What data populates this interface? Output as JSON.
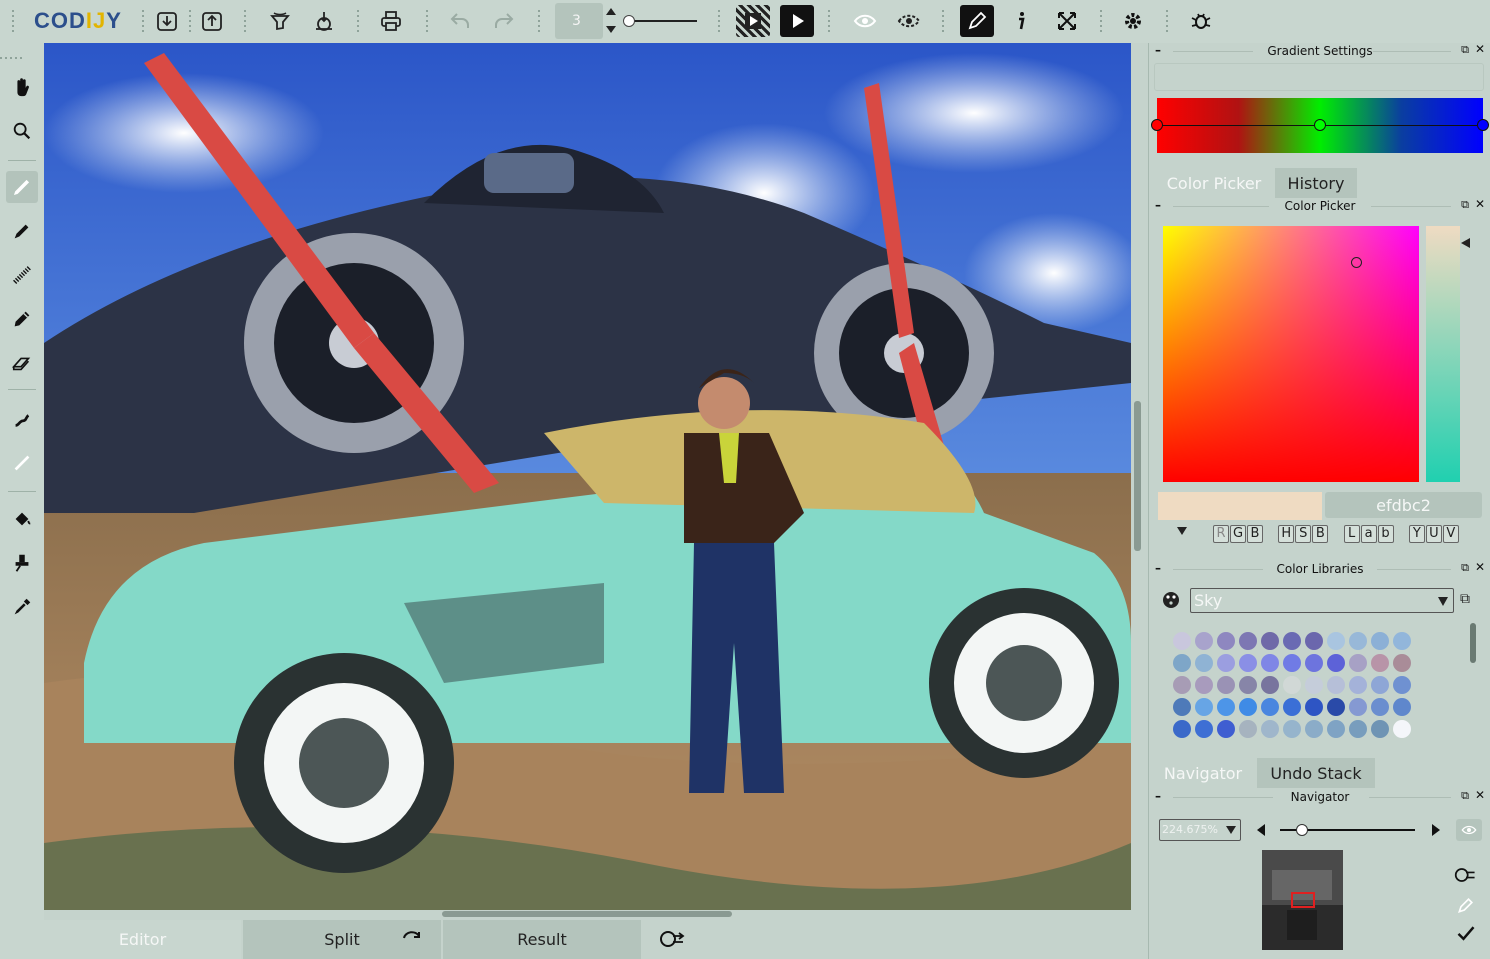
{
  "app": {
    "logo": "CODIJY",
    "logo_parts": [
      "COD",
      "IJ",
      "Y"
    ]
  },
  "toolbar": {
    "brush_size": "3",
    "icons": [
      "open-icon",
      "export-icon",
      "colorize-icon",
      "save-icon",
      "print-icon",
      "undo-icon",
      "redo-icon",
      "preview-hatched-icon",
      "play-icon",
      "eye-icon",
      "eye-masked-icon",
      "pen-active-icon",
      "info-icon",
      "fullscreen-icon",
      "settings-icon",
      "bug-icon"
    ]
  },
  "left_tools": [
    "hand-icon",
    "zoom-icon",
    "brush-icon",
    "marker-icon",
    "dotted-brush-icon",
    "pencil-icon",
    "eraser-icon",
    "smudge-icon",
    "line-icon",
    "fill-icon",
    "stamp-icon",
    "eyedropper-icon"
  ],
  "bottom_tabs": {
    "editor": "Editor",
    "split": "Split",
    "result": "Result"
  },
  "gradient_settings": {
    "title": "Gradient Settings",
    "stops": [
      "#ff0000",
      "#00ff00",
      "#0000ff"
    ]
  },
  "color_tabs": {
    "picker": "Color Picker",
    "history": "History"
  },
  "color_picker": {
    "title": "Color Picker",
    "hex": "efdbc2",
    "current_color": "#efdbc2",
    "modes": [
      [
        "R",
        "G",
        "B"
      ],
      [
        "H",
        "S",
        "B"
      ],
      [
        "L",
        "a",
        "b"
      ],
      [
        "Y",
        "U",
        "V"
      ]
    ]
  },
  "color_libraries": {
    "title": "Color Libraries",
    "selected": "Sky",
    "swatches": [
      [
        "#c9c7dd",
        "#a8a3cc",
        "#8e87c0",
        "#7d77b3",
        "#6f69a8",
        "#6a6ab3",
        "#6b67ad",
        "#a9c5e0",
        "#98b8d8",
        "#8cb0d6",
        "#92b6db"
      ],
      [
        "#7ea6c8",
        "#8fb3d4",
        "#9b9ee0",
        "#8a8fe6",
        "#7f86e6",
        "#707be5",
        "#6d74de",
        "#5d62d8",
        "#a7a1c5",
        "#b894a8",
        "#a98c98"
      ],
      [
        "#a79cb5",
        "#a89bbd",
        "#9a92b5",
        "#8785a8",
        "#78749e",
        "#d1d8d6",
        "#c5cdda",
        "#b6bfd8",
        "#a4b2d9",
        "#8ea6d6",
        "#6f91d1"
      ],
      [
        "#4e7ab9",
        "#67a5e5",
        "#4d95e8",
        "#3f8be6",
        "#4a86df",
        "#3b6fd6",
        "#2e55c4",
        "#2a4aa8",
        "#8599d2",
        "#6a8ecf",
        "#5f87cc"
      ],
      [
        "#3b69c9",
        "#3e6fd4",
        "#3f5ed1",
        "#a6b3bf",
        "#9fb6cb",
        "#96b4cc",
        "#8bacc8",
        "#7fa3c4",
        "#789dbd",
        "#6f94b4",
        "#f4f6fa"
      ]
    ]
  },
  "nav_tabs": {
    "navigator": "Navigator",
    "undo": "Undo Stack"
  },
  "navigator": {
    "title": "Navigator",
    "zoom": "224.675%"
  }
}
